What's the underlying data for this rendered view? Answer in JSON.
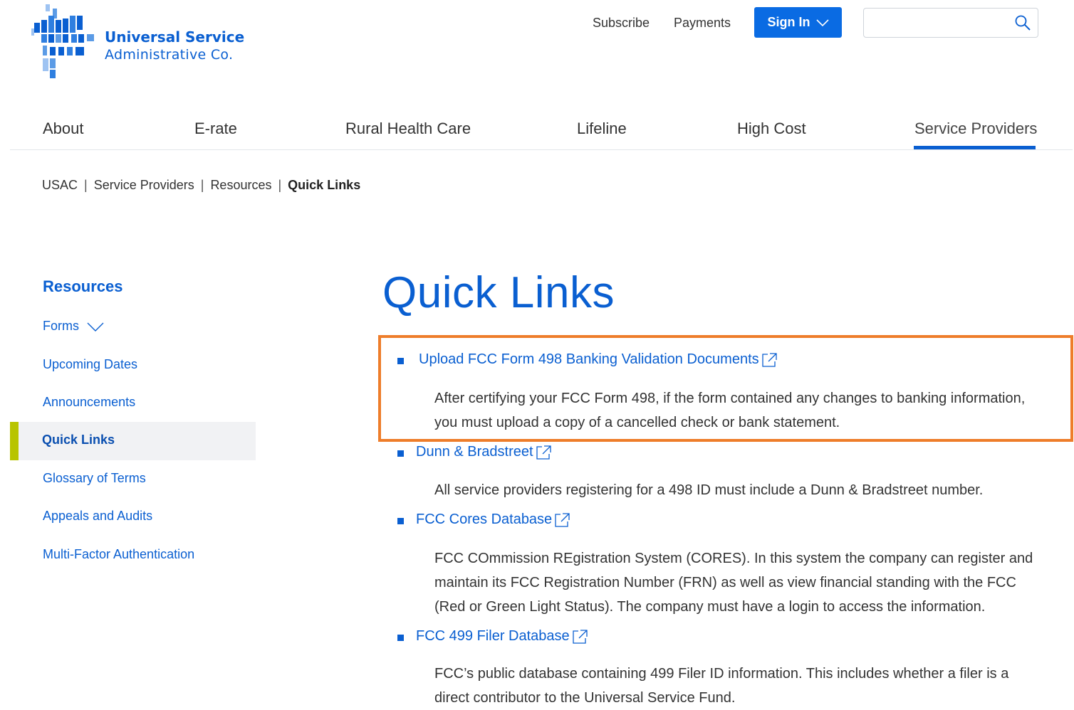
{
  "header": {
    "logo_line1": "Universal Service",
    "logo_line2": "Administrative Co.",
    "subscribe_label": "Subscribe",
    "payments_label": "Payments",
    "signin_label": "Sign In",
    "search_value": "",
    "search_placeholder": ""
  },
  "nav": {
    "items": [
      {
        "label": "About"
      },
      {
        "label": "E-rate"
      },
      {
        "label": "Rural Health Care"
      },
      {
        "label": "Lifeline"
      },
      {
        "label": "High Cost"
      },
      {
        "label": "Service Providers"
      }
    ],
    "active": "Service Providers"
  },
  "breadcrumb": {
    "items": [
      "USAC",
      "Service Providers",
      "Resources",
      "Quick Links"
    ],
    "separator": "|"
  },
  "sidebar": {
    "title": "Resources",
    "items": [
      {
        "label": "Forms"
      },
      {
        "label": "Upcoming Dates"
      },
      {
        "label": "Announcements"
      },
      {
        "label": "Quick Links"
      },
      {
        "label": "Glossary of Terms"
      },
      {
        "label": "Appeals and Audits"
      },
      {
        "label": "Multi-Factor Authentication"
      }
    ],
    "active": "Quick Links"
  },
  "main": {
    "title": "Quick Links",
    "links": [
      {
        "label": "Upload FCC Form 498 Banking Validation Documents",
        "description": "After certifying your FCC Form 498, if the form contained any changes to banking information, you must upload a copy of a cancelled check or bank statement."
      },
      {
        "label": "Dunn & Bradstreet",
        "description": "All service providers registering for a 498 ID must include a Dunn & Bradstreet number."
      },
      {
        "label": "FCC Cores Database",
        "description": "FCC COmmission REgistration System (CORES).  In this system the company can register and maintain its FCC Registration Number (FRN) as well as view financial standing with the FCC (Red or Green Light Status).  The company must have a login to access the information."
      },
      {
        "label": "FCC 499 Filer Database",
        "description": "FCC’s public database containing 499 Filer ID information. This includes whether a filer is a direct contributor to the Universal Service Fund."
      }
    ]
  },
  "colors": {
    "brand_blue": "#0a5fd1",
    "signin_blue": "#0a6be3",
    "sidebar_active_bar": "#b8c400",
    "highlight_orange": "#ee7d2a"
  },
  "icons": [
    "search-icon",
    "chevron-down-icon",
    "external-link-icon",
    "usac-logo-icon"
  ]
}
